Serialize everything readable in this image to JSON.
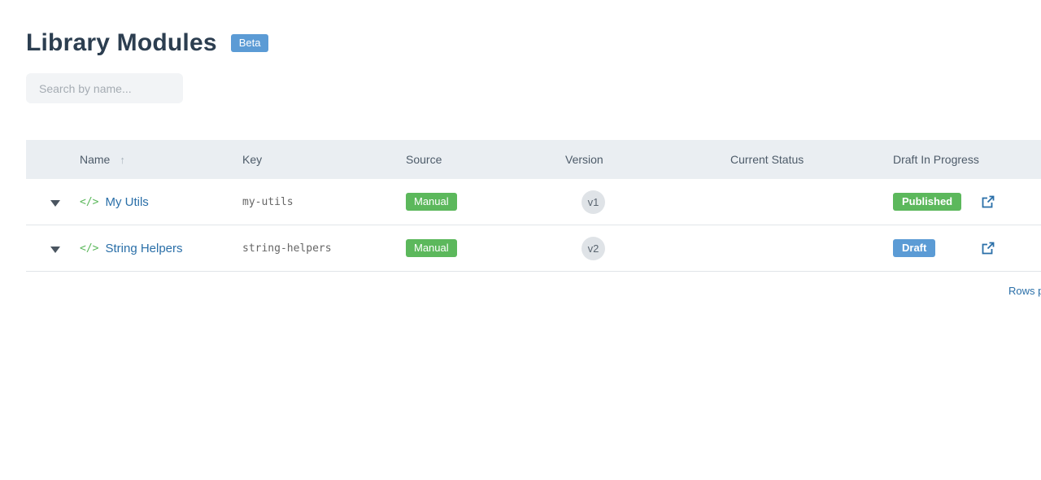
{
  "page": {
    "title": "Library Modules",
    "badge": "Beta"
  },
  "search": {
    "placeholder": "Search by name..."
  },
  "table": {
    "columns": {
      "name": "Name",
      "key": "Key",
      "source": "Source",
      "version": "Version",
      "current_status": "Current Status",
      "draft": "Draft In Progress"
    },
    "sort_icon": "↑",
    "code_icon": "</>",
    "rows": [
      {
        "name": "My Utils",
        "key": "my-utils",
        "source": "Manual",
        "version": "v1",
        "current_status": "",
        "draft": "Published",
        "draft_color": "#5cb85c"
      },
      {
        "name": "String Helpers",
        "key": "string-helpers",
        "source": "Manual",
        "version": "v2",
        "current_status": "",
        "draft": "Draft",
        "draft_color": "#5b9bd5"
      }
    ]
  },
  "footer": {
    "rows_per_page_label": "Rows p"
  },
  "colors": {
    "accent": "#5b9bd5",
    "success": "#5cb85c",
    "link": "#2a6fa8",
    "header_bg": "#eaeef2"
  }
}
